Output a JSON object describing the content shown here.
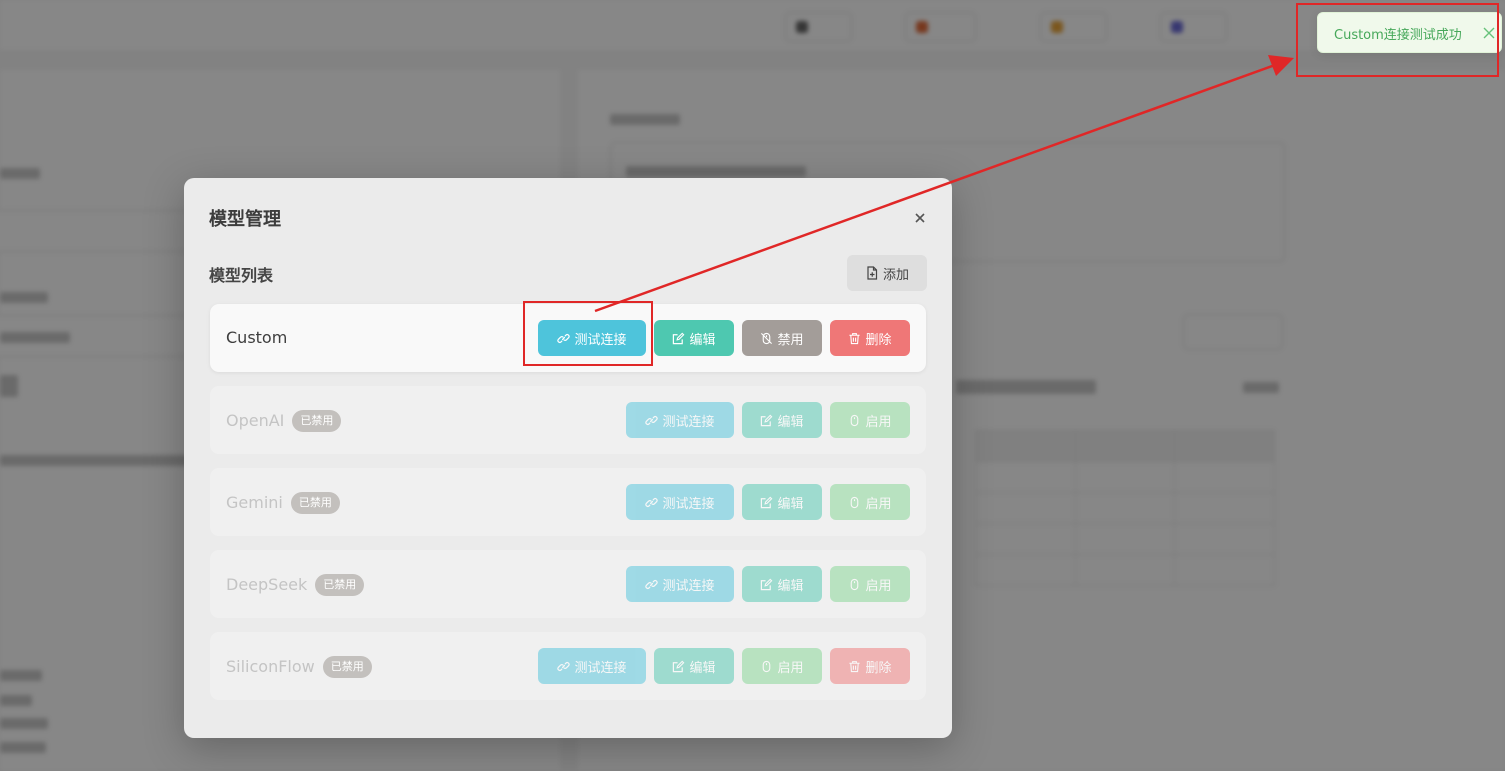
{
  "toast": {
    "message": "Custom连接测试成功"
  },
  "modal": {
    "title": "模型管理",
    "section_title": "模型列表",
    "add_label": "添加",
    "disabled_badge": "已禁用",
    "models": [
      {
        "name": "Custom",
        "disabled": false,
        "test_label": "测试连接",
        "edit_label": "编辑",
        "toggle_label": "禁用",
        "delete_label": "删除"
      },
      {
        "name": "OpenAI",
        "disabled": true,
        "test_label": "测试连接",
        "edit_label": "编辑",
        "toggle_label": "启用"
      },
      {
        "name": "Gemini",
        "disabled": true,
        "test_label": "测试连接",
        "edit_label": "编辑",
        "toggle_label": "启用"
      },
      {
        "name": "DeepSeek",
        "disabled": true,
        "test_label": "测试连接",
        "edit_label": "编辑",
        "toggle_label": "启用"
      },
      {
        "name": "SiliconFlow",
        "disabled": true,
        "test_label": "测试连接",
        "edit_label": "编辑",
        "toggle_label": "启用",
        "delete_label": "删除"
      }
    ]
  },
  "colors": {
    "test": "#4ec4db",
    "edit": "#4ec8b0",
    "disable": "#a39d99",
    "delete": "#ef7777",
    "enable": "#82d592",
    "toast_text": "#46a85a",
    "annotation": "#e02727"
  },
  "icons": {
    "test": "link-icon",
    "edit": "edit-icon",
    "disable": "mouse-off-icon",
    "enable": "mouse-icon",
    "delete": "trash-icon",
    "add": "file-add-icon",
    "close": "close-icon"
  }
}
